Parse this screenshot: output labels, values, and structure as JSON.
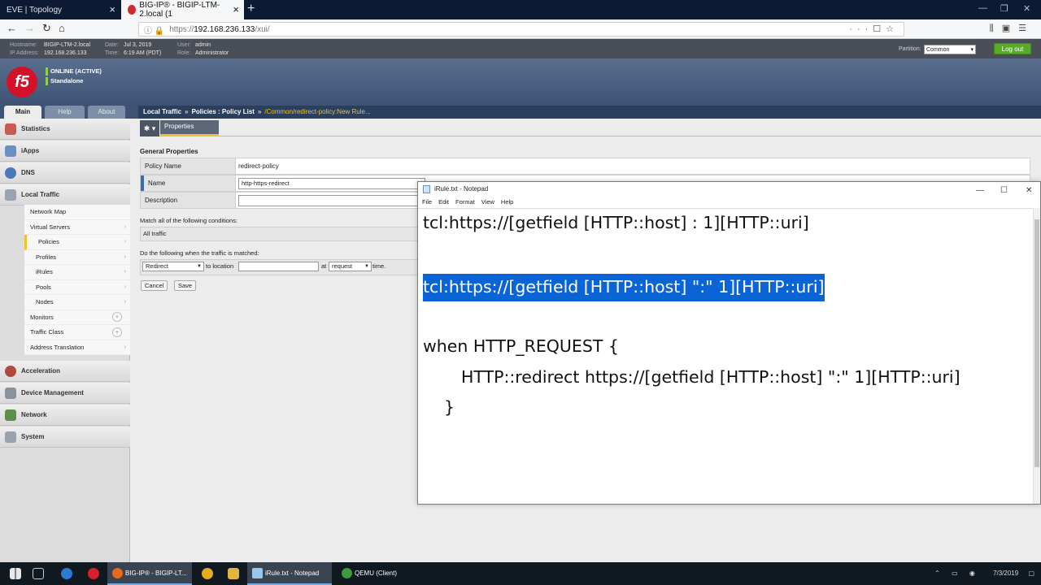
{
  "browser": {
    "tabs": [
      {
        "label": "EVE | Topology"
      },
      {
        "label": "BIG-IP® - BIGIP-LTM-2.local (1"
      }
    ],
    "url_protocol": "https://",
    "url_host": "192.168.236.133",
    "url_path": "/xui/"
  },
  "f5header": {
    "hostname_label": "Hostname:",
    "hostname": "BIGIP-LTM-2.local",
    "ip_label": "IP Address:",
    "ip": "192.168.236.133",
    "date_label": "Date:",
    "date": "Jul 3, 2019",
    "time_label": "Time:",
    "time": "6:19 AM (PDT)",
    "user_label": "User:",
    "user": "admin",
    "role_label": "Role:",
    "role": "Administrator",
    "partition_label": "Partition:",
    "partition": "Common",
    "logout": "Log out",
    "logo": "f5",
    "status1": "ONLINE (ACTIVE)",
    "status2": "Standalone"
  },
  "main_tabs": [
    "Main",
    "Help",
    "About"
  ],
  "breadcrumb": {
    "p1": "Local Traffic",
    "sep1": "»",
    "p2": "Policies : Policy List",
    "sep2": "»",
    "p3": "/Common/redirect-policy:New Rule..."
  },
  "leftnav": {
    "sections": [
      "Statistics",
      "iApps",
      "DNS",
      "Local Traffic",
      "Acceleration",
      "Device Management",
      "Network",
      "System"
    ],
    "local_traffic_items": [
      "Network Map",
      "Virtual Servers",
      "Policies",
      "Profiles",
      "iRules",
      "Pools",
      "Nodes",
      "Monitors",
      "Traffic Class",
      "Address Translation"
    ]
  },
  "content": {
    "properties_tab": "Properties",
    "general_properties": "General Properties",
    "policy_name_label": "Policy Name",
    "policy_name": "redirect-policy",
    "name_label": "Name",
    "name_value": "http-https-redirect",
    "description_label": "Description",
    "match_label": "Match all of the following conditions:",
    "match_value": "All traffic",
    "do_label": "Do the following when the traffic is matched:",
    "action": "Redirect",
    "to_location": "to location",
    "at": "at",
    "event": "request",
    "time": "time.",
    "cancel": "Cancel",
    "save": "Save"
  },
  "notepad": {
    "title": "iRule.txt - Notepad",
    "menu": [
      "File",
      "Edit",
      "Format",
      "View",
      "Help"
    ],
    "lines": [
      "tcl:https://[getfield [HTTP::host] : 1][HTTP::uri]",
      "tcl:https://[getfield [HTTP::host] \":\" 1][HTTP::uri]",
      "when HTTP_REQUEST {",
      "HTTP::redirect https://[getfield [HTTP::host] \":\" 1][HTTP::uri]",
      "}"
    ]
  },
  "taskbar": {
    "apps": [
      "BIG-IP® - BIGIP-LT...",
      "iRule.txt - Notepad",
      "QEMU (Client)"
    ],
    "date": "7/3/2019"
  },
  "colors": {
    "accent_yellow": "#f2c12e",
    "highlight": "#0a64d6",
    "logout_green": "#5aaa2a",
    "f5_red": "#d3122a"
  }
}
